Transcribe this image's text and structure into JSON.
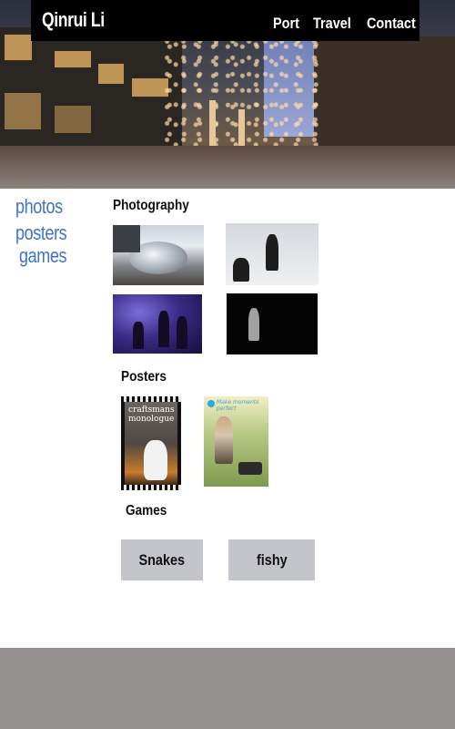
{
  "header": {
    "site_title": "Qinrui Li",
    "nav": [
      "Port",
      "Travel",
      "Contact"
    ]
  },
  "sidebar": {
    "links": [
      "photos",
      "posters",
      "games"
    ]
  },
  "sections": {
    "photography": {
      "heading": "Photography",
      "thumbnails": [
        "cloud-gate-sculpture-photo",
        "ice-skaters-photo",
        "concert-stage-photo",
        "dark-stage-performer-photo"
      ]
    },
    "posters": {
      "heading": "Posters",
      "items": [
        {
          "name": "craftsmans-monologue-poster",
          "text": "craftsmans monologue"
        },
        {
          "name": "make-moments-perfect-poster",
          "text": "Make moments perfect"
        }
      ]
    },
    "games": {
      "heading": "Games",
      "buttons": [
        "Snakes",
        "fishy"
      ]
    }
  },
  "colors": {
    "link": "#3f73c7",
    "header_bar": "#000000",
    "game_button": "#c4c5cb",
    "footer": "#948f8f"
  }
}
